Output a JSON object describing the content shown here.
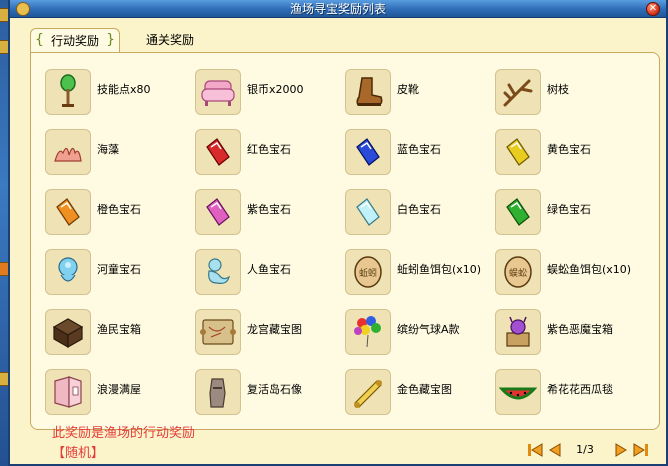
{
  "window": {
    "title": "渔场寻宝奖励列表"
  },
  "tabs": [
    {
      "label": "行动奖励",
      "active": true
    },
    {
      "label": "通关奖励",
      "active": false
    }
  ],
  "items": [
    {
      "label": "技能点x80",
      "icon": "skill-tree-icon"
    },
    {
      "label": "银币x2000",
      "icon": "pink-sofa-icon"
    },
    {
      "label": "皮靴",
      "icon": "leather-boot-icon"
    },
    {
      "label": "树枝",
      "icon": "branch-icon"
    },
    {
      "label": "海藻",
      "icon": "seaweed-icon"
    },
    {
      "label": "红色宝石",
      "icon": "red-gem-icon",
      "color": "#d82a2a"
    },
    {
      "label": "蓝色宝石",
      "icon": "blue-gem-icon",
      "color": "#2a4ad8"
    },
    {
      "label": "黄色宝石",
      "icon": "yellow-gem-icon",
      "color": "#e0c020"
    },
    {
      "label": "橙色宝石",
      "icon": "orange-gem-icon",
      "color": "#f09020"
    },
    {
      "label": "紫色宝石",
      "icon": "purple-gem-icon",
      "color": "#e060c0"
    },
    {
      "label": "白色宝石",
      "icon": "white-gem-icon",
      "color": "#a0e8f0"
    },
    {
      "label": "绿色宝石",
      "icon": "green-gem-icon",
      "color": "#30b030"
    },
    {
      "label": "河童宝石",
      "icon": "kappa-gem-icon",
      "color": "#70c8e8"
    },
    {
      "label": "人鱼宝石",
      "icon": "mermaid-gem-icon",
      "color": "#a0dce8"
    },
    {
      "label": "蚯蚓鱼饵包(x10)",
      "icon": "worm-bait-icon",
      "badge": "蚯蚓"
    },
    {
      "label": "蜈蚣鱼饵包(x10)",
      "icon": "centipede-bait-icon",
      "badge": "蜈蚣"
    },
    {
      "label": "渔民宝箱",
      "icon": "fisher-chest-icon"
    },
    {
      "label": "龙宫藏宝图",
      "icon": "dragon-map-icon"
    },
    {
      "label": "缤纷气球A款",
      "icon": "balloons-icon"
    },
    {
      "label": "紫色恶魔宝箱",
      "icon": "demon-box-icon"
    },
    {
      "label": "浪漫满屋",
      "icon": "romantic-house-icon"
    },
    {
      "label": "复活岛石像",
      "icon": "moai-statue-icon"
    },
    {
      "label": "金色藏宝图",
      "icon": "gold-map-icon"
    },
    {
      "label": "希花花西瓜毯",
      "icon": "watermelon-rug-icon"
    }
  ],
  "footer": {
    "note": "此奖励是渔场的行动奖励",
    "tag": "【随机】"
  },
  "pager": {
    "page": "1/3"
  }
}
